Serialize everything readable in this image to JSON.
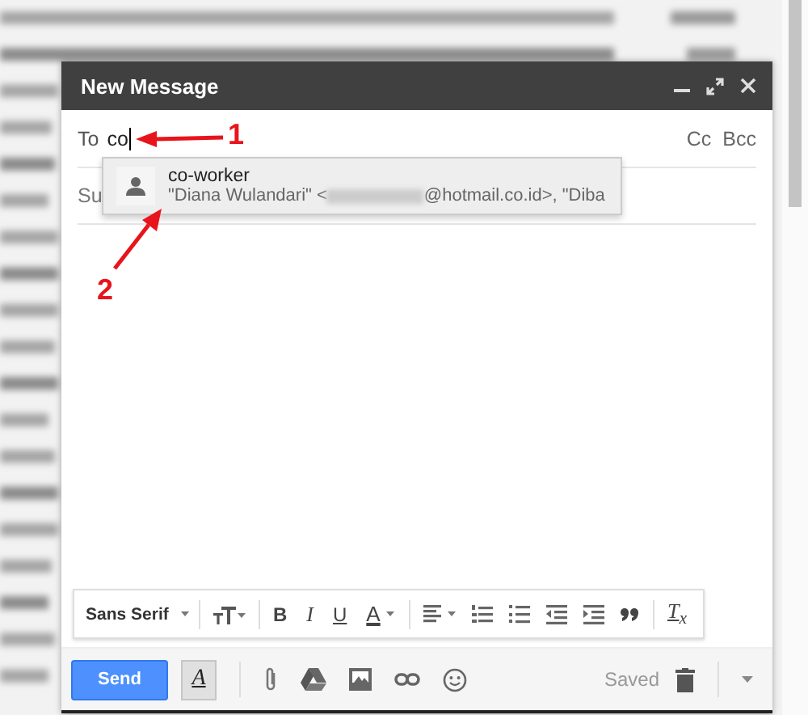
{
  "window": {
    "title": "New Message"
  },
  "to": {
    "label": "To",
    "value": "co",
    "cc": "Cc",
    "bcc": "Bcc"
  },
  "subject": {
    "placeholder": "Su"
  },
  "suggestions": [
    {
      "name": "co-worker",
      "address_start": "\"Diana Wulandari\" <",
      "address_end": "@hotmail.co.id>, \"Diba",
      "selected": true
    }
  ],
  "format_toolbar": [
    {
      "kind": "font",
      "label": "Sans Serif"
    },
    {
      "kind": "size"
    },
    {
      "kind": "bold",
      "label": "B"
    },
    {
      "kind": "italic",
      "label": "I"
    },
    {
      "kind": "underline",
      "label": "U"
    },
    {
      "kind": "color",
      "label": "A"
    },
    {
      "kind": "align"
    },
    {
      "kind": "numbered-list"
    },
    {
      "kind": "bulleted-list"
    },
    {
      "kind": "indent-less"
    },
    {
      "kind": "indent-more"
    },
    {
      "kind": "quote"
    },
    {
      "kind": "clear",
      "label": "T$_{x}$"
    }
  ],
  "footer": {
    "send": "Send",
    "formatting": {
      "label": "A",
      "selected": true
    },
    "status": "Saved"
  },
  "annotations": [
    {
      "label": "1"
    },
    {
      "label": "2"
    }
  ]
}
